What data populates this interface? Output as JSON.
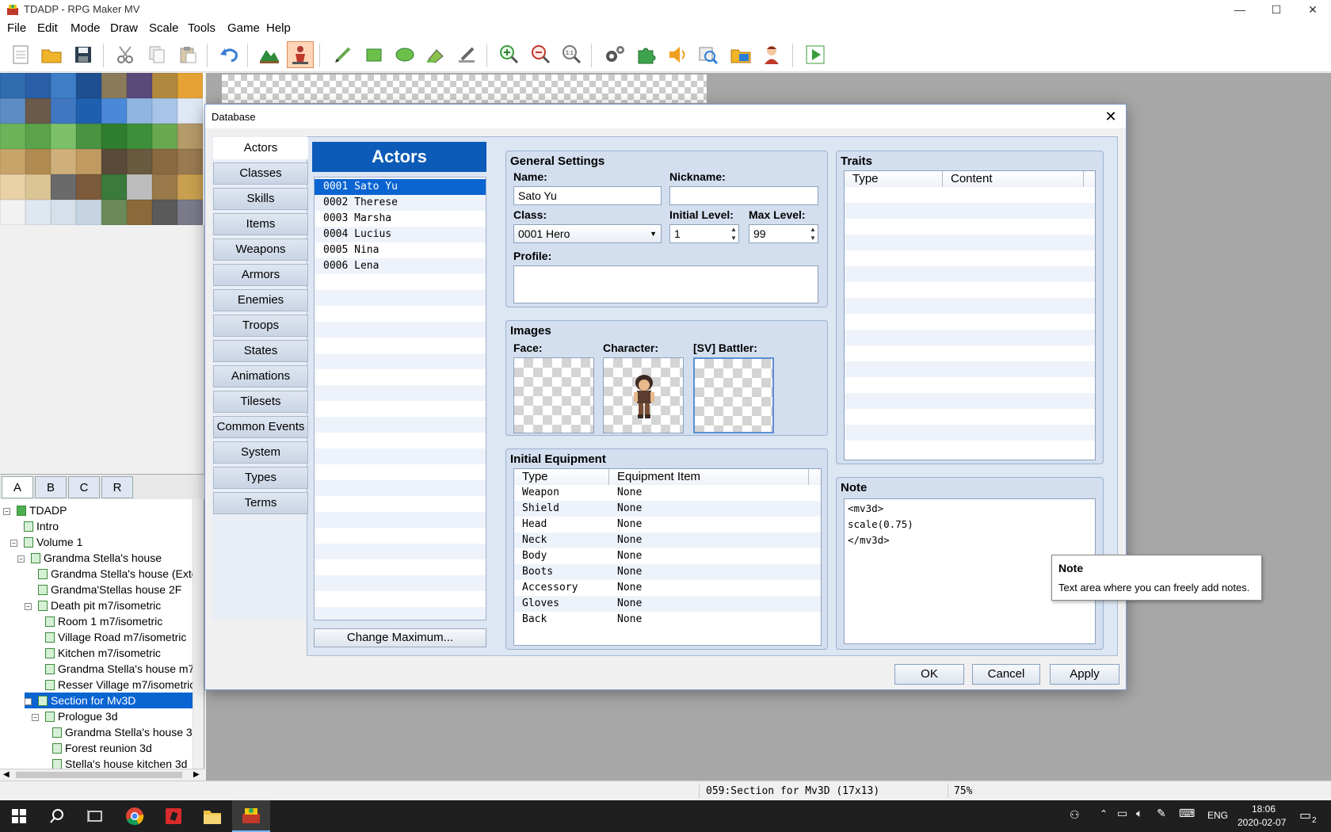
{
  "window": {
    "title": "TDADP - RPG Maker MV",
    "minimize": "—",
    "maximize": "☐",
    "close": "✕"
  },
  "menu": [
    "File",
    "Edit",
    "Mode",
    "Draw",
    "Scale",
    "Tools",
    "Game",
    "Help"
  ],
  "tileset_tabs": [
    "A",
    "B",
    "C",
    "R"
  ],
  "map_tree": {
    "items": [
      {
        "label": "TDADP",
        "level": 0,
        "expander": "⊟",
        "root": true
      },
      {
        "label": "Intro",
        "level": 1
      },
      {
        "label": "Volume 1",
        "level": 1,
        "expander": "⊟"
      },
      {
        "label": "Grandma Stella's house",
        "level": 2,
        "expander": "⊟"
      },
      {
        "label": "Grandma Stella's house (Exter",
        "level": 3
      },
      {
        "label": "Grandma'Stellas house 2F",
        "level": 3
      },
      {
        "label": "Death pit m7/isometric",
        "level": 3,
        "expander": "⊟"
      },
      {
        "label": "Room 1 m7/isometric",
        "level": 4
      },
      {
        "label": "Village Road m7/isometric",
        "level": 4
      },
      {
        "label": "Kitchen m7/isometric",
        "level": 4
      },
      {
        "label": "Grandma Stella's house m7/is",
        "level": 4
      },
      {
        "label": "Resser Village m7/isometric",
        "level": 4
      },
      {
        "label": "Section for Mv3D",
        "level": 3,
        "expander": "⊟",
        "selected": true
      },
      {
        "label": "Prologue 3d",
        "level": 4,
        "expander": "⊟"
      },
      {
        "label": "Grandma Stella's house 3d",
        "level": 5
      },
      {
        "label": "Forest reunion 3d",
        "level": 5
      },
      {
        "label": "Stella's house kitchen 3d",
        "level": 5
      }
    ]
  },
  "status": {
    "map_info": "059:Section for Mv3D (17x13)",
    "zoom": "75%"
  },
  "taskbar": {
    "lang": "ENG",
    "time": "18:06",
    "date": "2020-02-07",
    "notifications": "2"
  },
  "dialog": {
    "title": "Database",
    "categories": [
      "Actors",
      "Classes",
      "Skills",
      "Items",
      "Weapons",
      "Armors",
      "Enemies",
      "Troops",
      "States",
      "Animations",
      "Tilesets",
      "Common Events",
      "System",
      "Types",
      "Terms"
    ],
    "list_header": "Actors",
    "actors": [
      "0001 Sato Yu",
      "0002 Therese",
      "0003 Marsha",
      "0004 Lucius",
      "0005 Nina",
      "0006 Lena"
    ],
    "change_max": "Change Maximum...",
    "general": {
      "title": "General Settings",
      "name_label": "Name:",
      "name": "Sato Yu",
      "nickname_label": "Nickname:",
      "nickname": "",
      "class_label": "Class:",
      "class": "0001 Hero",
      "initial_level_label": "Initial Level:",
      "initial_level": "1",
      "max_level_label": "Max Level:",
      "max_level": "99",
      "profile_label": "Profile:",
      "profile": ""
    },
    "images": {
      "title": "Images",
      "face": "Face:",
      "character": "Character:",
      "battler": "[SV] Battler:"
    },
    "equipment": {
      "title": "Initial Equipment",
      "col_type": "Type",
      "col_item": "Equipment Item",
      "rows": [
        {
          "type": "Weapon",
          "item": "None"
        },
        {
          "type": "Shield",
          "item": "None"
        },
        {
          "type": "Head",
          "item": "None"
        },
        {
          "type": "Neck",
          "item": "None"
        },
        {
          "type": "Body",
          "item": "None"
        },
        {
          "type": "Boots",
          "item": "None"
        },
        {
          "type": "Accessory",
          "item": "None"
        },
        {
          "type": "Gloves",
          "item": "None"
        },
        {
          "type": "Back",
          "item": "None"
        }
      ]
    },
    "traits": {
      "title": "Traits",
      "col_type": "Type",
      "col_content": "Content"
    },
    "note": {
      "title": "Note",
      "lines": [
        "<mv3d>",
        "scale(0.75)",
        "</mv3d>"
      ]
    },
    "tooltip": {
      "title": "Note",
      "text": "Text area where you can freely add notes."
    },
    "buttons": {
      "ok": "OK",
      "cancel": "Cancel",
      "apply": "Apply"
    }
  },
  "colors": {
    "accent": "#0a64d2",
    "header_blue": "#0d5bb8",
    "panel": "#d3dfef",
    "map_bg": "#a7a7a7"
  }
}
